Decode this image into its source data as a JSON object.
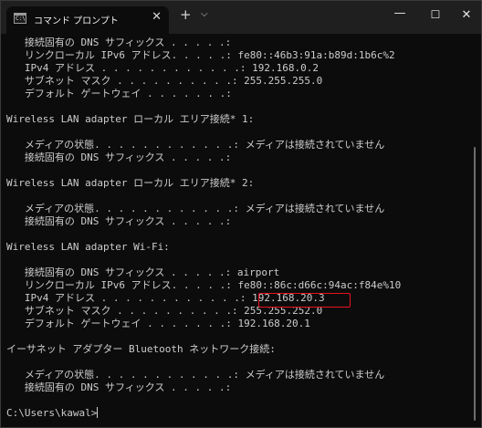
{
  "window": {
    "tab_title": "コマンド プロンプト",
    "tab_icon_text": "C:\\",
    "close_tab_glyph": "✕",
    "new_tab_glyph": "+",
    "dropdown_glyph": "⌵",
    "minimize_glyph": "—",
    "maximize_glyph": "☐",
    "close_glyph": "✕"
  },
  "console": {
    "lines": [
      "   接続固有の DNS サフィックス . . . . .:",
      "   リンクローカル IPv6 アドレス. . . . .: fe80::46b3:91a:b89d:1b6c%2",
      "   IPv4 アドレス . . . . . . . . . . . .: 192.168.0.2",
      "   サブネット マスク . . . . . . . . . .: 255.255.255.0",
      "   デフォルト ゲートウェイ . . . . . . .:",
      "",
      "Wireless LAN adapter ローカル エリア接続* 1:",
      "",
      "   メディアの状態. . . . . . . . . . . .: メディアは接続されていません",
      "   接続固有の DNS サフィックス . . . . .:",
      "",
      "Wireless LAN adapter ローカル エリア接続* 2:",
      "",
      "   メディアの状態. . . . . . . . . . . .: メディアは接続されていません",
      "   接続固有の DNS サフィックス . . . . .:",
      "",
      "Wireless LAN adapter Wi-Fi:",
      "",
      "   接続固有の DNS サフィックス . . . . .: airport",
      "   リンクローカル IPv6 アドレス. . . . .: fe80::86c:d66c:94ac:f84e%10",
      "   IPv4 アドレス . . . . . . . . . . . .: 192.168.20.3",
      "   サブネット マスク . . . . . . . . . .: 255.255.252.0",
      "   デフォルト ゲートウェイ . . . . . . .: 192.168.20.1",
      "",
      "イーサネット アダプター Bluetooth ネットワーク接続:",
      "",
      "   メディアの状態. . . . . . . . . . . .: メディアは接続されていません",
      "   接続固有の DNS サフィックス . . . . .:",
      "",
      "C:\\Users\\kawal>"
    ]
  }
}
